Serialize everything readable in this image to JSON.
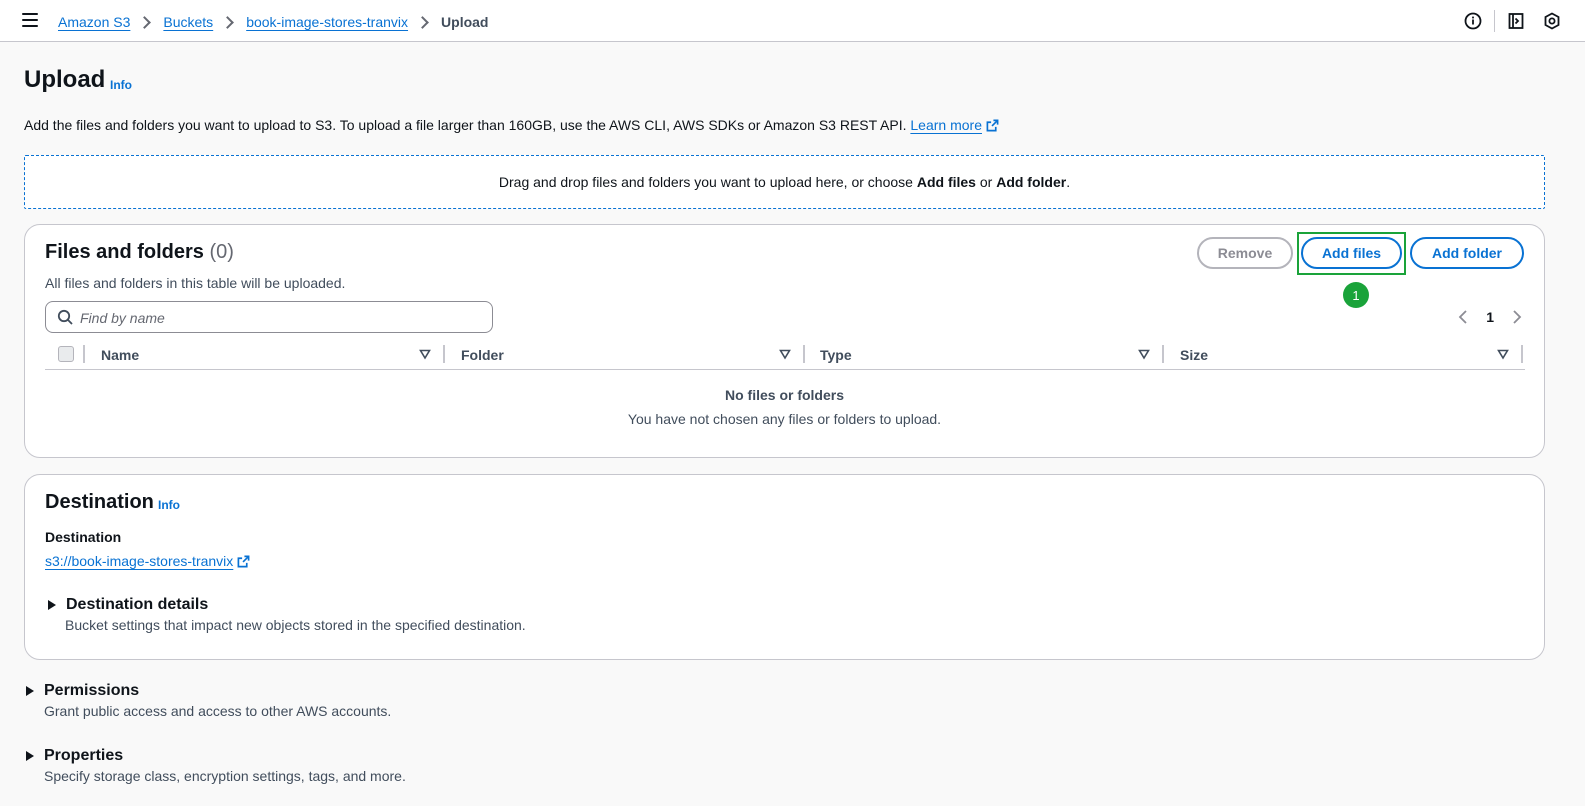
{
  "breadcrumbs": [
    "Amazon S3",
    "Buckets",
    "book-image-stores-tranvix"
  ],
  "breadcrumb_current": "Upload",
  "page": {
    "title": "Upload",
    "info": "Info",
    "description": "Add the files and folders you want to upload to S3. To upload a file larger than 160GB, use the AWS CLI, AWS SDKs or Amazon S3 REST API.",
    "learn_more": "Learn more"
  },
  "dropzone": {
    "text_before": "Drag and drop files and folders you want to upload here, or choose ",
    "add_files": "Add files",
    "or": " or ",
    "add_folder": "Add folder",
    "period": "."
  },
  "files": {
    "title": "Files and folders",
    "count": "(0)",
    "subtitle": "All files and folders in this table will be uploaded.",
    "remove_label": "Remove",
    "add_files_label": "Add files",
    "add_folder_label": "Add folder",
    "marker": "1",
    "search_placeholder": "Find by name",
    "page_number": "1",
    "columns": [
      "Name",
      "Folder",
      "Type",
      "Size"
    ],
    "empty_title": "No files or folders",
    "empty_sub": "You have not chosen any files or folders to upload."
  },
  "destination": {
    "title": "Destination",
    "info": "Info",
    "label": "Destination",
    "link": "s3://book-image-stores-tranvix",
    "details_title": "Destination details",
    "details_sub": "Bucket settings that impact new objects stored in the specified destination."
  },
  "permissions": {
    "title": "Permissions",
    "sub": "Grant public access and access to other AWS accounts."
  },
  "properties": {
    "title": "Properties",
    "sub": "Specify storage class, encryption settings, tags, and more."
  },
  "colors": {
    "accent": "#0972d3",
    "highlight": "#1aa33a",
    "text": "#0f141a",
    "muted": "#414d5c"
  },
  "icons": [
    "menu-icon",
    "info-circle-icon",
    "notes-icon",
    "cloudshell-icon",
    "external-link-icon",
    "search-icon",
    "chevron-left-icon",
    "chevron-right-icon",
    "sort-icon",
    "caret-right-icon"
  ]
}
